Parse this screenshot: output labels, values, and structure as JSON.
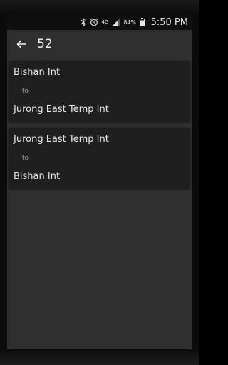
{
  "status_bar": {
    "network_type": "4G",
    "battery_percent": "84%",
    "time": "5:50 PM",
    "icons": [
      "bluetooth-icon",
      "alarm-icon",
      "network-4g-icon",
      "signal-icon",
      "battery-icon"
    ]
  },
  "toolbar": {
    "title": "52",
    "back_icon": "arrow-left-icon"
  },
  "routes": [
    {
      "from": "Bishan Int",
      "connector": "to",
      "to": "Jurong East Temp Int"
    },
    {
      "from": "Jurong East Temp Int",
      "connector": "to",
      "to": "Bishan Int"
    }
  ],
  "colors": {
    "app_background": "#2f2f2f",
    "card_background": "#1f1f1f",
    "text_primary": "#e8e8e8",
    "text_secondary": "#9a9a9a"
  }
}
